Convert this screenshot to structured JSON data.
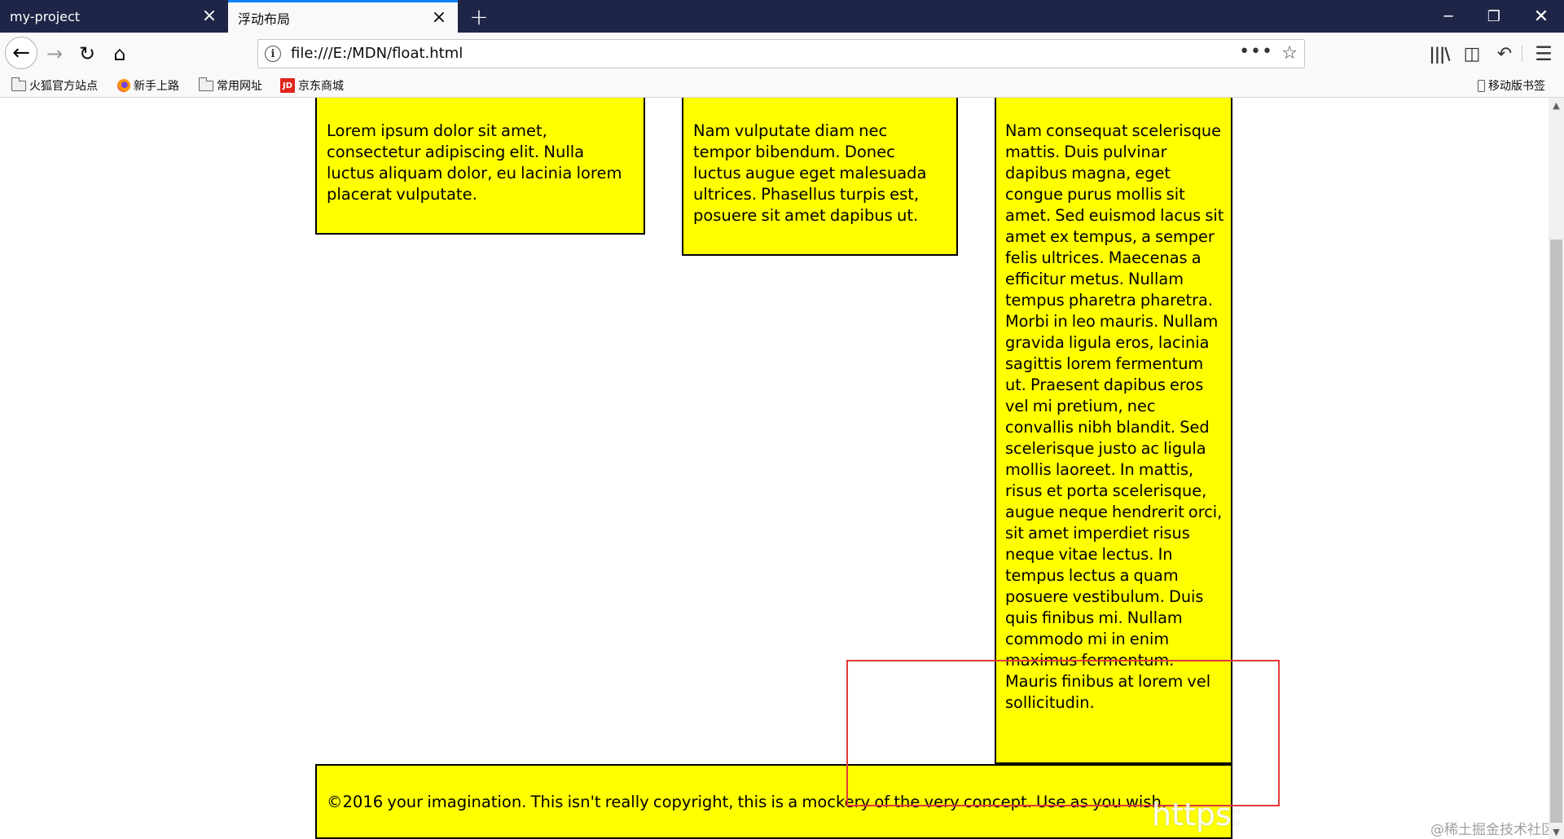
{
  "tabs": [
    {
      "label": "my-project",
      "active": false
    },
    {
      "label": "浮动布局",
      "active": true
    }
  ],
  "icons": {
    "close_tab": "×",
    "new_tab": "+",
    "minimize": "─",
    "restore": "❐",
    "close_window": "✕",
    "back": "←",
    "forward": "→",
    "reload": "↻",
    "home": "⌂",
    "info": "i",
    "more": "•••",
    "star": "☆",
    "library": "|||\\",
    "sidebar": "◫",
    "undo": "↶",
    "menu": "☰",
    "jd": "JD",
    "scroll_up": "▲",
    "scroll_down": "▼"
  },
  "address_bar": {
    "url": "file:///E:/MDN/float.html"
  },
  "bookmarks": {
    "items": [
      {
        "label": "火狐官方站点",
        "icon": "folder-icon"
      },
      {
        "label": "新手上路",
        "icon": "firefox-icon"
      },
      {
        "label": "常用网址",
        "icon": "folder-icon"
      },
      {
        "label": "京东商城",
        "icon": "jd-icon"
      }
    ],
    "mobile": "移动版书签"
  },
  "content": {
    "column1": "Lorem ipsum dolor sit amet, consectetur adipiscing elit. Nulla luctus aliquam dolor, eu lacinia lorem placerat vulputate.",
    "column2": "Nam vulputate diam nec tempor bibendum. Donec luctus augue eget malesuada ultrices. Phasellus turpis est, posuere sit amet dapibus ut.",
    "column3": "Nam consequat scelerisque mattis. Duis pulvinar dapibus magna, eget congue purus mollis sit amet. Sed euismod lacus sit amet ex tempus, a semper felis ultrices. Maecenas a efficitur metus. Nullam tempus pharetra pharetra. Morbi in leo mauris. Nullam gravida ligula eros, lacinia sagittis lorem fermentum ut. Praesent dapibus eros vel mi pretium, nec convallis nibh blandit. Sed scelerisque justo ac ligula mollis laoreet. In mattis, risus et porta scelerisque, augue neque hendrerit orci, sit amet imperdiet risus neque vitae lectus. In tempus lectus a quam posuere vestibulum. Duis quis finibus mi. Nullam commodo mi in enim maximus fermentum. Mauris finibus at lorem vel sollicitudin.",
    "footer": "©2016 your imagination. This isn't really copyright, this is a mockery of the very concept. Use as you wish."
  },
  "watermark": {
    "url_text": "https:",
    "site": "@稀土掘金技术社区"
  },
  "colors": {
    "box_background": "#ffff00",
    "annotation": "#e03a3a",
    "tab_strip": "#1f2546",
    "active_tab_accent": "#0a84ff"
  }
}
